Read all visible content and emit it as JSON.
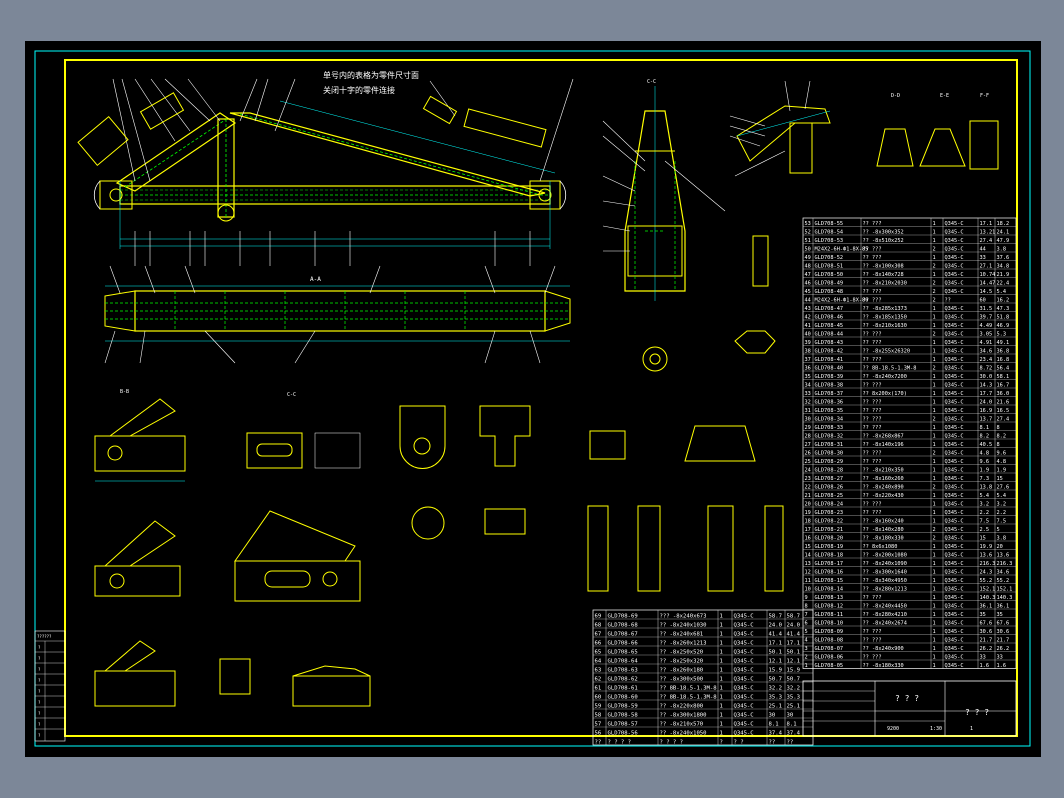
{
  "colors": {
    "background": "#000000",
    "frame": "#ffff00",
    "outer_border": "#00ffff",
    "part_outline": "#ffff00",
    "hidden_line": "#00ff00",
    "dimension": "#00ffff",
    "leader": "#ffffff",
    "annotation": "#ffffff",
    "table_line": "#ffffff",
    "chrome": "#7c8798"
  },
  "drawing": {
    "note_line_1": "单号内的表格为零件尺寸面",
    "note_line_2": "关闭十字的零件连接",
    "view_a_a": "A-A",
    "view_b_b": "B-B",
    "view_c_c": "C-C",
    "title_block": {
      "name_cell": "? ? ?",
      "drawing_no_cell": "? ? ?",
      "scale": "1:30",
      "sheet": "1",
      "weight": "9200"
    }
  },
  "parts_table_right": {
    "rows": [
      [
        "53",
        "GLD708-55",
        "?? ???",
        "1",
        "Q345-C",
        "17.1",
        "18.2"
      ],
      [
        "52",
        "GLD708-54",
        "?? -8x300x352",
        "1",
        "Q345-C",
        "13.21",
        "24.1"
      ],
      [
        "51",
        "GLD708-53",
        "?? -8x510x252",
        "1",
        "Q345-C",
        "27.4",
        "47.9"
      ],
      [
        "50",
        "M24X2-6H-Ф1-8X-85",
        "?? ???",
        "2",
        "Q345-C",
        "44",
        "3.8"
      ],
      [
        "49",
        "GLD708-52",
        "?? ???",
        "1",
        "Q345-C",
        "33",
        "37.6"
      ],
      [
        "48",
        "GLD708-51",
        "?? -8x100x308",
        "2",
        "Q345-C",
        "27.1",
        "34.8"
      ],
      [
        "47",
        "GLD708-50",
        "?? -8x140x728",
        "1",
        "Q345-C",
        "10.74",
        "21.9"
      ],
      [
        "46",
        "GLD708-49",
        "?? -8x210x2030",
        "2",
        "Q345-C",
        "14.47",
        "22.4"
      ],
      [
        "45",
        "GLD708-48",
        "?? ???",
        "2",
        "Q345-C",
        "14.5",
        "5.4"
      ],
      [
        "44",
        "M24X2-6H-Ф1-8X-80",
        "?? ???",
        "2",
        "??",
        "60",
        "16.2"
      ],
      [
        "43",
        "GLD708-47",
        "?? -8x285x1373",
        "1",
        "Q345-C",
        "31.5",
        "47.3"
      ],
      [
        "42",
        "GLD708-46",
        "?? -8x185x1350",
        "1",
        "Q345-C",
        "39.7",
        "51.8"
      ],
      [
        "41",
        "GLD708-45",
        "?? -8x210x1630",
        "1",
        "Q345-C",
        "4.49",
        "46.9"
      ],
      [
        "40",
        "GLD708-44",
        "?? ???",
        "2",
        "Q345-C",
        "3.05",
        "5.3"
      ],
      [
        "39",
        "GLD708-43",
        "?? ???",
        "1",
        "Q345-C",
        "4.91",
        "49.1"
      ],
      [
        "38",
        "GLD708-42",
        "?? -8x255x26320",
        "1",
        "Q345-C",
        "34.6",
        "36.8"
      ],
      [
        "37",
        "GLD708-41",
        "?? ???",
        "1",
        "Q345-C",
        "23.4",
        "16.8"
      ],
      [
        "36",
        "GLD708-40",
        "?? 8B-18.5-1.3M-8",
        "2",
        "Q345-C",
        "8.72",
        "56.4"
      ],
      [
        "35",
        "GLD708-39",
        "?? -8x240x7200",
        "1",
        "Q345-C",
        "30.0",
        "58.1"
      ],
      [
        "34",
        "GLD708-38",
        "?? ???",
        "1",
        "Q345-C",
        "14.3",
        "16.7"
      ],
      [
        "33",
        "GLD708-37",
        "?? 8x200x(170)",
        "1",
        "Q345-C",
        "17.7",
        "36.0"
      ],
      [
        "32",
        "GLD708-36",
        "?? ???",
        "1",
        "Q345-C",
        "24.0",
        "21.6"
      ],
      [
        "31",
        "GLD708-35",
        "?? ???",
        "1",
        "Q345-C",
        "16.9",
        "16.5"
      ],
      [
        "30",
        "GLD708-34",
        "?? ???",
        "2",
        "Q345-C",
        "13.7",
        "27.4"
      ],
      [
        "29",
        "GLD708-33",
        "?? ???",
        "1",
        "Q345-C",
        "8.1",
        "8"
      ],
      [
        "28",
        "GLD708-32",
        "?? -8x268x867",
        "1",
        "Q345-C",
        "8.2",
        "8.2"
      ],
      [
        "27",
        "GLD708-31",
        "?? -8x140x196",
        "1",
        "Q345-C",
        "40.5",
        "8"
      ],
      [
        "26",
        "GLD708-30",
        "?? ???",
        "2",
        "Q345-C",
        "4.8",
        "9.6"
      ],
      [
        "25",
        "GLD708-29",
        "?? ???",
        "1",
        "Q345-C",
        "9.6",
        "4.8"
      ],
      [
        "24",
        "GLD708-28",
        "?? -8x210x350",
        "1",
        "Q345-C",
        "1.9",
        "1.9"
      ],
      [
        "23",
        "GLD708-27",
        "?? -8x160x260",
        "1",
        "Q345-C",
        "7.3",
        "15"
      ],
      [
        "22",
        "GLD708-26",
        "?? -8x240x890",
        "2",
        "Q345-C",
        "13.8",
        "27.6"
      ],
      [
        "21",
        "GLD708-25",
        "?? -8x220x430",
        "1",
        "Q345-C",
        "5.4",
        "5.4"
      ],
      [
        "20",
        "GLD708-24",
        "?? ???",
        "1",
        "Q345-C",
        "3.2",
        "3.2"
      ],
      [
        "19",
        "GLD708-23",
        "?? ???",
        "1",
        "Q345-C",
        "2.2",
        "2.2"
      ],
      [
        "18",
        "GLD708-22",
        "?? -8x160x240",
        "1",
        "Q345-C",
        "7.5",
        "7.5"
      ],
      [
        "17",
        "GLD708-21",
        "?? -8x140x280",
        "2",
        "Q345-C",
        "2.5",
        "5"
      ],
      [
        "16",
        "GLD708-20",
        "?? -8x180x330",
        "2",
        "Q345-C",
        "15",
        "3.8"
      ],
      [
        "15",
        "GLD708-19",
        "?? 8x6x1080",
        "1",
        "Q345-C",
        "19.9",
        "20"
      ],
      [
        "14",
        "GLD708-18",
        "?? -8x200x1080",
        "1",
        "Q345-C",
        "13.6",
        "13.6"
      ],
      [
        "13",
        "GLD708-17",
        "?? -8x240x1090",
        "1",
        "Q345-C",
        "216.3",
        "216.3"
      ],
      [
        "12",
        "GLD708-16",
        "?? -8x300x1640",
        "1",
        "Q345-C",
        "24.3",
        "34.6"
      ],
      [
        "11",
        "GLD708-15",
        "?? -8x340x4950",
        "1",
        "Q345-C",
        "55.2",
        "55.2"
      ],
      [
        "10",
        "GLD708-14",
        "?? -8x280x1213",
        "1",
        "Q345-C",
        "152.1",
        "152.1"
      ],
      [
        "9",
        "GLD708-13",
        "?? ???",
        "1",
        "Q345-C",
        "140.3",
        "140.3"
      ],
      [
        "8",
        "GLD708-12",
        "?? -8x240x4450",
        "1",
        "Q345-C",
        "36.1",
        "36.1"
      ],
      [
        "7",
        "GLD708-11",
        "?? -8x280x4210",
        "1",
        "Q345-C",
        "35",
        "35"
      ],
      [
        "6",
        "GLD708-10",
        "?? -8x240x2674",
        "1",
        "Q345-C",
        "67.6",
        "67.6"
      ],
      [
        "5",
        "GLD708-09",
        "?? ???",
        "1",
        "Q345-C",
        "30.6",
        "30.6"
      ],
      [
        "4",
        "GLD708-08",
        "?? ???",
        "1",
        "Q345-C",
        "21.7",
        "21.7"
      ],
      [
        "3",
        "GLD708-07",
        "?? -8x240x900",
        "1",
        "Q345-C",
        "26.2",
        "26.2"
      ],
      [
        "2",
        "GLD708-06",
        "?? ???",
        "1",
        "Q345-C",
        "33",
        "33"
      ],
      [
        "1",
        "GLD708-05",
        "?? -8x180x330",
        "1",
        "Q345-C",
        "1.6",
        "1.6"
      ]
    ]
  },
  "parts_table_bottom": {
    "rows": [
      [
        "69",
        "GLD708-69",
        "??? -8x240x673",
        "1",
        "Q345-C",
        "58.7",
        "58.7"
      ],
      [
        "68",
        "GLD708-68",
        "?? -8x240x1030",
        "1",
        "Q345-C",
        "24.0",
        "24.0"
      ],
      [
        "67",
        "GLD708-67",
        "?? -8x240x681",
        "1",
        "Q345-C",
        "41.4",
        "41.4"
      ],
      [
        "66",
        "GLD708-66",
        "?? -8x260x1213",
        "1",
        "Q345-C",
        "17.1",
        "17.1"
      ],
      [
        "65",
        "GLD708-65",
        "?? -8x250x520",
        "1",
        "Q345-C",
        "50.1",
        "50.1"
      ],
      [
        "64",
        "GLD708-64",
        "?? -8x250x320",
        "1",
        "Q345-C",
        "12.1",
        "12.1"
      ],
      [
        "63",
        "GLD708-63",
        "?? -8x260x180",
        "1",
        "Q345-C",
        "15.9",
        "15.9"
      ],
      [
        "62",
        "GLD708-62",
        "?? -8x300x500",
        "1",
        "Q345-C",
        "50.7",
        "50.7"
      ],
      [
        "61",
        "GLD708-61",
        "?? 8B-18.5-1.3M-8",
        "1",
        "Q345-C",
        "32.2",
        "32.2"
      ],
      [
        "60",
        "GLD708-60",
        "?? 8B-18.5-1.3M-8",
        "1",
        "Q345-C",
        "35.3",
        "35.3"
      ],
      [
        "59",
        "GLD708-59",
        "?? -8x220x800",
        "1",
        "Q345-C",
        "25.1",
        "25.1"
      ],
      [
        "58",
        "GLD708-58",
        "?? -8x300x1800",
        "1",
        "Q345-C",
        "30",
        "30"
      ],
      [
        "57",
        "GLD708-57",
        "?? -8x210x570",
        "1",
        "Q345-C",
        "8.1",
        "8.1"
      ],
      [
        "56",
        "GLD708-56",
        "?? -8x240x1050",
        "1",
        "Q345-C",
        "37.4",
        "37.4"
      ]
    ],
    "header": [
      "??",
      "? ? ? ?",
      "? ? ? ?",
      "?",
      "? ?",
      "??",
      "??"
    ]
  },
  "left_change_table": {
    "header": "??????",
    "rows": [
      "?",
      "?",
      "?",
      "?",
      "?",
      "?",
      "?",
      "?",
      "?"
    ]
  }
}
